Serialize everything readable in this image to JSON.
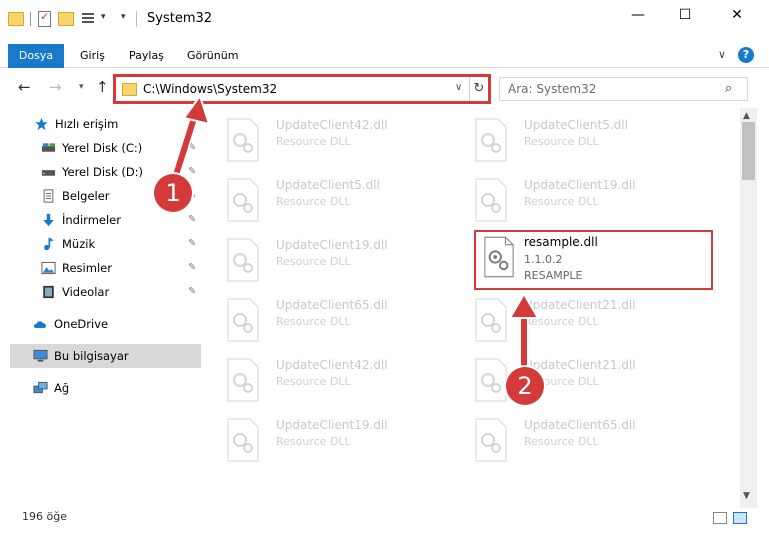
{
  "window": {
    "title": "System32",
    "minimize": "—",
    "maximize": "☐",
    "close": "✕"
  },
  "ribbon": {
    "tabs": [
      "Dosya",
      "Giriş",
      "Paylaş",
      "Görünüm"
    ],
    "collapse": "∨",
    "help": "?"
  },
  "nav": {
    "back": "←",
    "forward": "→",
    "recent": "▾",
    "up": "↑",
    "address": "C:\\Windows\\System32",
    "address_dd": "∨",
    "refresh": "↻",
    "search_placeholder": "Ara: System32",
    "search_icon": "⌕"
  },
  "sidebar": {
    "items": [
      {
        "label": "Hızlı erişim",
        "icon": "star-icon",
        "pinned": false
      },
      {
        "label": "Yerel Disk (C:)",
        "icon": "drive-icon",
        "pinned": true
      },
      {
        "label": "Yerel Disk (D:)",
        "icon": "drive-icon",
        "pinned": true
      },
      {
        "label": "Belgeler",
        "icon": "document-icon",
        "pinned": true
      },
      {
        "label": "İndirmeler",
        "icon": "download-icon",
        "pinned": true
      },
      {
        "label": "Müzik",
        "icon": "music-icon",
        "pinned": true
      },
      {
        "label": "Resimler",
        "icon": "picture-icon",
        "pinned": true
      },
      {
        "label": "Videolar",
        "icon": "video-icon",
        "pinned": true
      },
      {
        "label": "OneDrive",
        "icon": "cloud-icon",
        "pinned": false
      },
      {
        "label": "Bu bilgisayar",
        "icon": "computer-icon",
        "pinned": false
      },
      {
        "label": "Ağ",
        "icon": "network-icon",
        "pinned": false
      }
    ],
    "pin_glyph": "📌"
  },
  "files": {
    "col1": [
      {
        "name": "UpdateClient42.dll",
        "desc": "Resource DLL"
      },
      {
        "name": "UpdateClient5.dll",
        "desc": "Resource DLL"
      },
      {
        "name": "UpdateClient19.dll",
        "desc": "Resource DLL"
      },
      {
        "name": "UpdateClient65.dll",
        "desc": "Resource DLL"
      },
      {
        "name": "UpdateClient42.dll",
        "desc": "Resource DLL"
      },
      {
        "name": "UpdateClient19.dll",
        "desc": "Resource DLL"
      }
    ],
    "col2": [
      {
        "name": "UpdateClient5.dll",
        "desc": "Resource DLL"
      },
      {
        "name": "UpdateClient19.dll",
        "desc": "Resource DLL"
      },
      {
        "name": "UpdateClient21.dll",
        "desc": "Resource DLL"
      },
      {
        "name": "UpdateClient21.dll",
        "desc": "Resource DLL"
      },
      {
        "name": "UpdateClient65.dll",
        "desc": "Resource DLL"
      }
    ],
    "highlighted": {
      "name": "resample.dll",
      "version": "1.1.0.2",
      "desc": "RESAMPLE"
    }
  },
  "status": {
    "count": "196 öğe"
  },
  "annotations": {
    "step1": "1",
    "step2": "2",
    "color": "#d53a3a"
  }
}
